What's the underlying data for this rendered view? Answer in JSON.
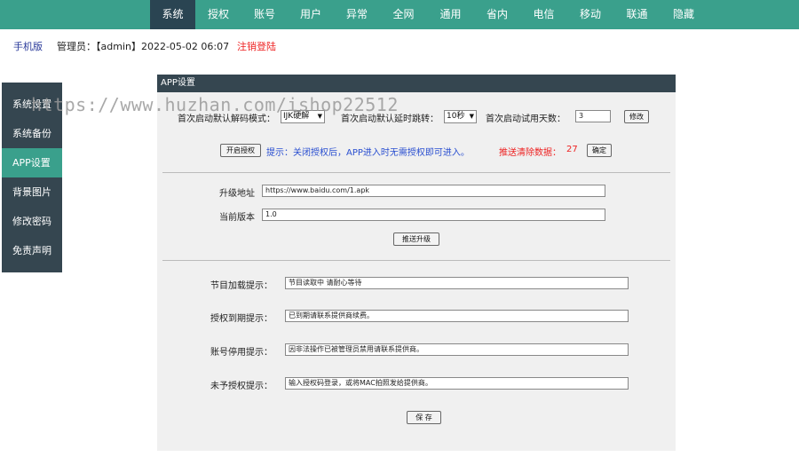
{
  "topnav": {
    "items": [
      "系统",
      "授权",
      "账号",
      "用户",
      "异常",
      "全网",
      "通用",
      "省内",
      "电信",
      "移动",
      "联通",
      "隐藏"
    ],
    "active_color": "#2a4452",
    "bar_color": "#3aa08c"
  },
  "infobar": {
    "mobile": "手机版",
    "admin": "管理员：【admin】2022-05-02 06:07",
    "logout": "注销登陆"
  },
  "sidebar": {
    "items": [
      "系统设置",
      "系统备份",
      "APP设置",
      "背景图片",
      "修改密码",
      "免责声明"
    ]
  },
  "watermark": "https://www.huzhan.com/ishop22512",
  "panel": {
    "title": "APP设置",
    "decode_mode_label": "首次启动默认解码模式：",
    "decode_mode_value": "IJK硬解",
    "delay_label": "首次启动默认延时跳转：",
    "delay_value": "10秒",
    "trial_days_label": "首次启动试用天数：",
    "trial_days_value": "3",
    "modify_button": "修改",
    "auth_button": "开启授权",
    "auth_hint": "提示：关闭授权后，APP进入时无需授权即可进入。",
    "push_clear_label": "推送清除数据：",
    "push_clear_count": "27",
    "confirm_button": "确定",
    "upgrade_url_label": "升级地址",
    "upgrade_url_value": "https://www.baidu.com/1.apk",
    "current_version_label": "当前版本",
    "current_version_value": "1.0",
    "push_upgrade_button": "推送升级",
    "loading_tip_label": "节目加载提示：",
    "loading_tip_value": "节目读取中  请耐心等待",
    "expire_tip_label": "授权到期提示：",
    "expire_tip_value": "已到期请联系提供商续费。",
    "disabled_tip_label": "账号停用提示：",
    "disabled_tip_value": "因非法操作已被管理员禁用请联系提供商。",
    "unauth_tip_label": "未予授权提示：",
    "unauth_tip_value": "输入授权码登录，或将MAC拍照发给提供商。",
    "save_button": "保 存"
  }
}
